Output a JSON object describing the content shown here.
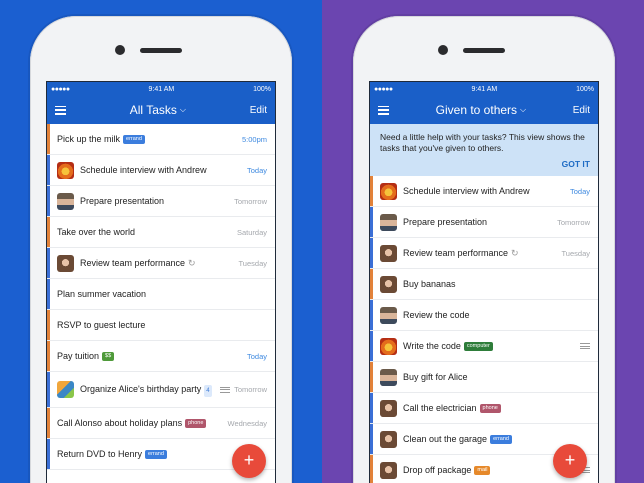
{
  "colors": {
    "left_bg": "#1b5fd0",
    "right_bg": "#6b45b0",
    "navbar": "#1a5fc8",
    "fab": "#e84a3a",
    "info_bg": "#cde2f7"
  },
  "status_bar": {
    "signal": "●●●●●",
    "time": "9:41 AM",
    "battery": "100%"
  },
  "left": {
    "title": "All Tasks",
    "edit": "Edit",
    "tasks": [
      {
        "text": "Pick up the milk",
        "tag": "errand",
        "date": "5:00pm",
        "today": true
      },
      {
        "text": "Schedule interview with Andrew",
        "date": "Today",
        "today": true,
        "avatar": "fire"
      },
      {
        "text": "Prepare presentation",
        "date": "Tomorrow",
        "avatar": "man"
      },
      {
        "text": "Take over the world",
        "date": "Saturday"
      },
      {
        "text": "Review team performance",
        "date": "Tuesday",
        "avatar": "woman",
        "repeat": true
      },
      {
        "text": "Plan summer vacation"
      },
      {
        "text": "RSVP to guest lecture"
      },
      {
        "text": "Pay tuition",
        "tag": "$$",
        "date": "Today",
        "today": true
      },
      {
        "text": "Organize Alice's birthday party",
        "subcount": "4",
        "date": "Tomorrow",
        "avatar": "birthday",
        "notes": true
      },
      {
        "text": "Call Alonso about holiday plans",
        "tag": "phone",
        "date": "Wednesday"
      },
      {
        "text": "Return DVD to Henry",
        "tag": "errand"
      }
    ]
  },
  "right": {
    "title": "Given to others",
    "edit": "Edit",
    "info": "Need a little help with your tasks? This view shows the tasks that you've given to others.",
    "got_it": "GOT IT",
    "tasks": [
      {
        "text": "Schedule interview with Andrew",
        "date": "Today",
        "today": true,
        "avatar": "fire"
      },
      {
        "text": "Prepare presentation",
        "date": "Tomorrow",
        "avatar": "man"
      },
      {
        "text": "Review team performance",
        "date": "Tuesday",
        "avatar": "woman",
        "repeat": true
      },
      {
        "text": "Buy bananas",
        "avatar": "woman"
      },
      {
        "text": "Review the code",
        "avatar": "man"
      },
      {
        "text": "Write the code",
        "tag": "computer",
        "avatar": "fire",
        "notes": true
      },
      {
        "text": "Buy gift for Alice",
        "avatar": "man"
      },
      {
        "text": "Call the electrician",
        "tag": "phone",
        "avatar": "woman"
      },
      {
        "text": "Clean out the garage",
        "tag": "errand",
        "avatar": "woman"
      },
      {
        "text": "Drop off package",
        "tag": "mail",
        "avatar": "woman",
        "notes": true
      }
    ]
  },
  "fab_label": "+",
  "tag_colors": {
    "errand": "#3b7ddd",
    "$$": "#4f9a3a",
    "phone": "#b0566b",
    "computer": "#2e7d3a",
    "mail": "#e6892a"
  }
}
